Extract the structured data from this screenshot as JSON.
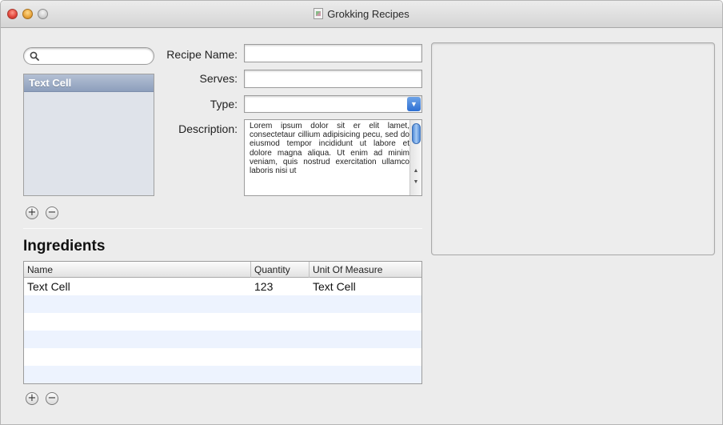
{
  "window": {
    "title": "Grokking Recipes"
  },
  "search": {
    "value": ""
  },
  "recipe_list": {
    "items": [
      {
        "label": "Text Cell"
      }
    ]
  },
  "form": {
    "recipe_name_label": "Recipe Name:",
    "recipe_name_value": "",
    "serves_label": "Serves:",
    "serves_value": "",
    "type_label": "Type:",
    "type_value": "",
    "description_label": "Description:",
    "description_value": "Lorem ipsum dolor sit er elit lamet, consectetaur cillium adipisicing pecu, sed do eiusmod tempor incididunt ut labore et dolore magna aliqua. Ut enim ad minim veniam, quis nostrud exercitation ullamco laboris nisi ut"
  },
  "ingredients": {
    "heading": "Ingredients",
    "columns": [
      "Name",
      "Quantity",
      "Unit Of Measure"
    ],
    "rows": [
      {
        "name": "Text Cell",
        "quantity": "123",
        "unit": "Text Cell"
      }
    ]
  },
  "colors": {
    "window_bg": "#ececec",
    "selection": "#8d9fbc",
    "alt_row": "#edf3fe",
    "select_accent": "#2d6fd3"
  },
  "icons": {
    "search": "magnifier-icon",
    "add": "plus-icon",
    "remove": "minus-icon"
  }
}
